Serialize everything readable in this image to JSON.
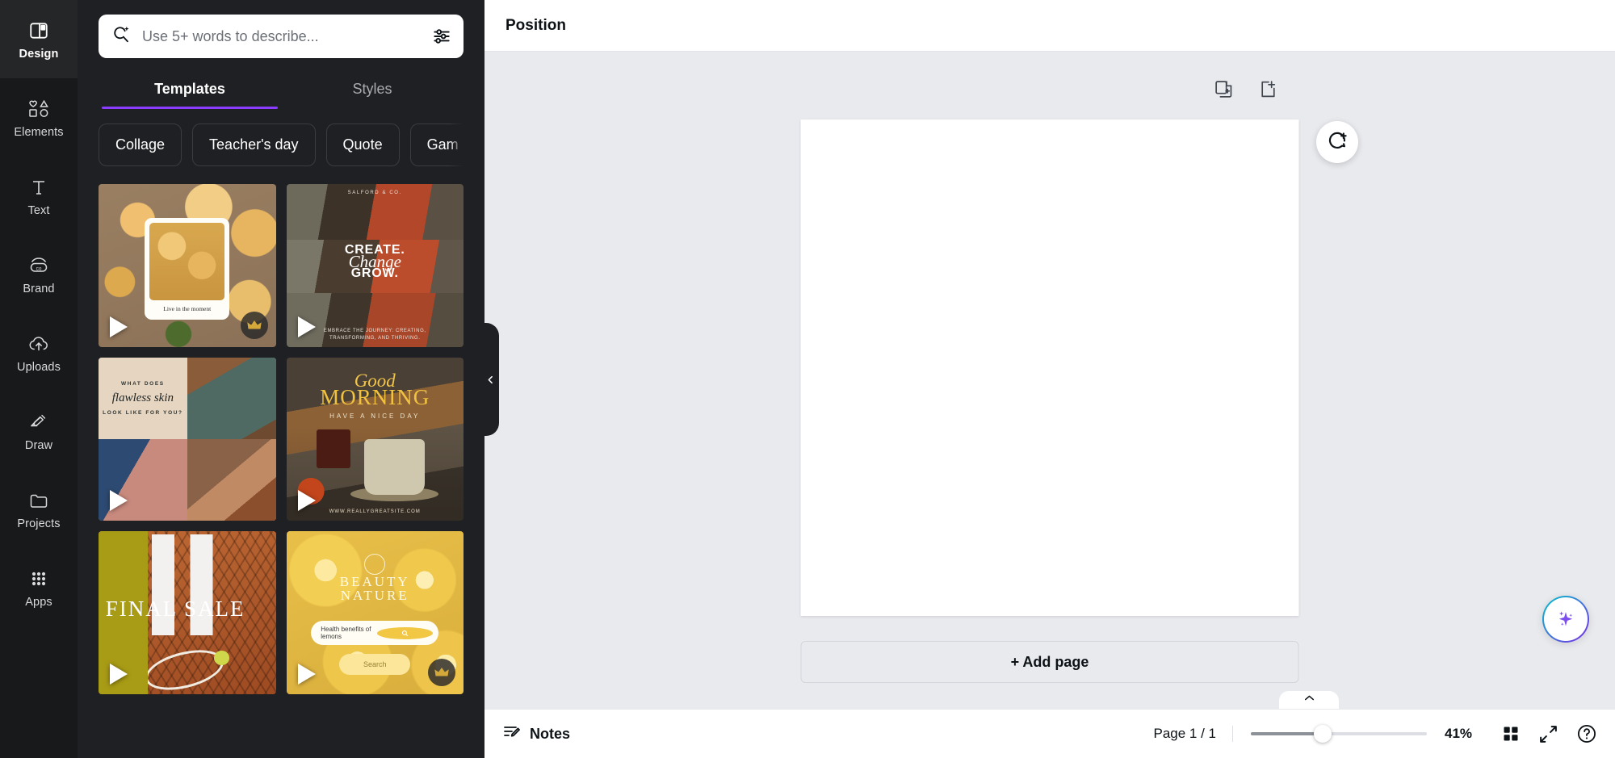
{
  "rail": {
    "items": [
      {
        "label": "Design",
        "icon": "layout-icon",
        "active": true
      },
      {
        "label": "Elements",
        "icon": "shapes-icon",
        "active": false
      },
      {
        "label": "Text",
        "icon": "text-icon",
        "active": false
      },
      {
        "label": "Brand",
        "icon": "brand-icon",
        "active": false
      },
      {
        "label": "Uploads",
        "icon": "upload-icon",
        "active": false
      },
      {
        "label": "Draw",
        "icon": "pen-icon",
        "active": false
      },
      {
        "label": "Projects",
        "icon": "folder-icon",
        "active": false
      },
      {
        "label": "Apps",
        "icon": "grid-apps-icon",
        "active": false
      }
    ]
  },
  "search": {
    "placeholder": "Use 5+ words to describe...",
    "value": "",
    "icon": "magic-search-icon",
    "filter_icon": "sliders-icon"
  },
  "tabs": [
    {
      "label": "Templates",
      "active": true
    },
    {
      "label": "Styles",
      "active": false
    }
  ],
  "chips": [
    {
      "label": "Collage"
    },
    {
      "label": "Teacher's day"
    },
    {
      "label": "Quote"
    },
    {
      "label": "Gam"
    }
  ],
  "chips_next_icon": "chevron-right-icon",
  "templates": [
    {
      "name": "live-in-the-moment-flowers",
      "caption": "Live in the moment",
      "pro": true
    },
    {
      "name": "create-change-grow",
      "brand": "SALFORD & CO.",
      "line1": "CREATE.",
      "line2": "Change",
      "line3": "GROW.",
      "footer": "EMBRACE THE JOURNEY: CREATING, TRANSFORMING, AND THRIVING.",
      "pro": false
    },
    {
      "name": "flawless-skin-collage",
      "kicker": "WHAT DOES",
      "main": "flawless skin",
      "sub": "LOOK LIKE FOR YOU?",
      "pro": false
    },
    {
      "name": "good-morning-coffee",
      "line1": "Good",
      "line2": "MORNING",
      "line3": "HAVE A NICE DAY",
      "url": "WWW.REALLYGREATSITE.COM",
      "pro": false
    },
    {
      "name": "final-sale-tennis",
      "title": "FINAL SALE",
      "pro": false
    },
    {
      "name": "beauty-nature-lemons",
      "line1": "BEAUTY",
      "line2": "NATURE",
      "field": "Health benefits of lemons",
      "button": "Search",
      "pro": true
    }
  ],
  "canvas": {
    "title": "Position",
    "duplicate_icon": "duplicate-page-icon",
    "addpage_icon": "add-page-icon",
    "comment_icon": "add-comment-icon",
    "ai_icon": "magic-sparkle-icon",
    "add_page_label": "+ Add page",
    "collapse_icon": "chevron-up-icon",
    "panel_collapse_icon": "chevron-left-icon"
  },
  "bottombar": {
    "notes_label": "Notes",
    "notes_icon": "notes-pencil-icon",
    "page_count": "Page 1 / 1",
    "zoom_value": "41%",
    "grid_icon": "grid-view-icon",
    "fullscreen_icon": "expand-icon",
    "help_icon": "help-icon"
  },
  "colors": {
    "accent_purple": "#8b3dff",
    "panel_bg": "#1f2023",
    "rail_bg": "#18191b",
    "canvas_bg": "#e9eaee"
  }
}
